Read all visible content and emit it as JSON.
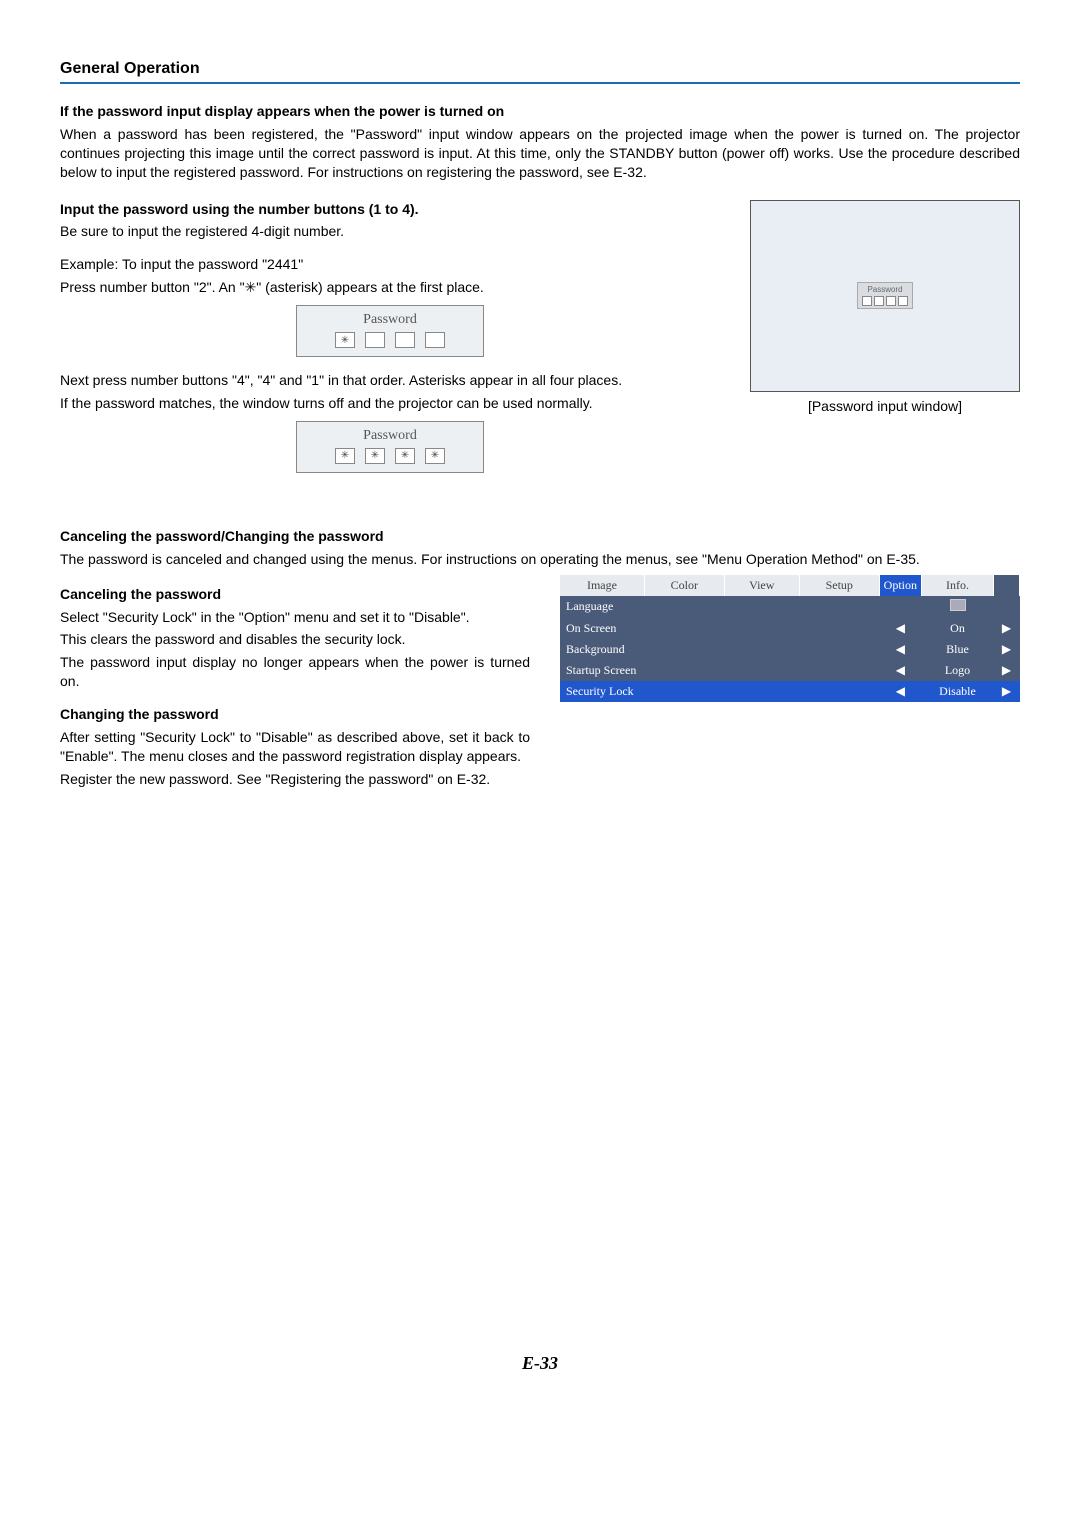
{
  "title": "General Operation",
  "h1": "If the password input display appears when the power is turned on",
  "p1": "When a password has been registered, the \"Password\" input window appears on the projected image when the power is turned on. The projector continues projecting this image until the correct password is input. At this time, only the STANDBY button (power off) works. Use the procedure described below to input the registered password. For instructions on registering the password, see E-32.",
  "h2": "Input the password using the number buttons (1 to 4).",
  "p2": "Be sure to input the registered 4-digit number.",
  "p3": "Example: To input the password \"2441\"",
  "p4": "Press number button \"2\". An \"✳\" (asterisk) appears at the first place.",
  "pwLabel": "Password",
  "p5": "Next press number buttons \"4\", \"4\" and \"1\" in that order. Asterisks appear in all four places.",
  "p6": "If the password matches, the window turns off and the projector can be used normally.",
  "caption1": "[Password input window]",
  "h3": "Canceling the password/Changing the password",
  "p7": "The password is canceled and changed using the menus. For instructions on operating the menus, see \"Menu Operation Method\" on E-35.",
  "h4": "Canceling the password",
  "p8": "Select \"Security Lock\" in the \"Option\" menu and set it to \"Disable\".",
  "p9": "This clears the password and disables the security lock.",
  "p10": "The password input display no longer appears when the power is turned on.",
  "h5": "Changing the password",
  "p11": "After setting \"Security Lock\" to \"Disable\" as described above, set it back to \"Enable\". The menu closes and the password registration display appears.",
  "p12": "Register the new password. See \"Registering the password\" on E-32.",
  "menu": {
    "tabs": [
      "Image",
      "Color",
      "View",
      "Setup",
      "Option",
      "Info."
    ],
    "activeTab": "Option",
    "rows": [
      {
        "label": "Language",
        "value": "",
        "enter": true
      },
      {
        "label": "On Screen",
        "value": "On"
      },
      {
        "label": "Background",
        "value": "Blue"
      },
      {
        "label": "Startup Screen",
        "value": "Logo"
      },
      {
        "label": "Security Lock",
        "value": "Disable",
        "sel": true
      }
    ]
  },
  "asterisk": "✳",
  "leftTri": "◀",
  "rightTri": "▶",
  "pageNum": "E-33"
}
